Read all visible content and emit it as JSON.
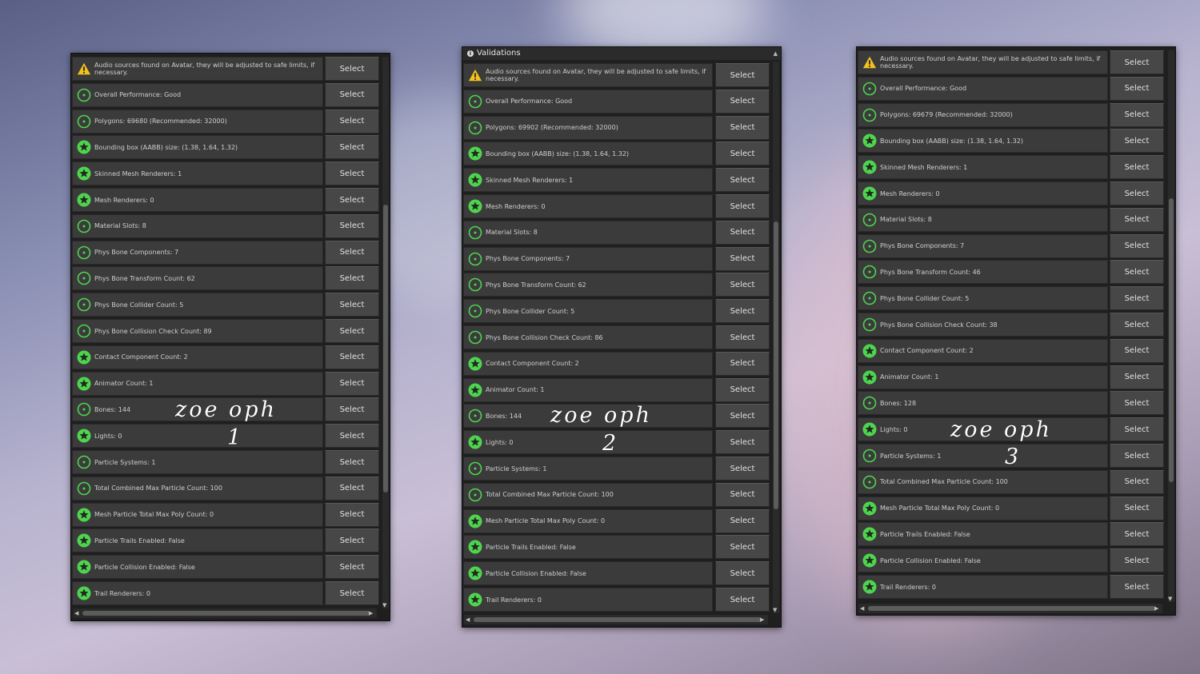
{
  "panels": [
    {
      "has_title": false,
      "title": "",
      "handwriting": {
        "line1": "zoe oph",
        "line2": "1"
      },
      "rows": [
        {
          "icon": "warning",
          "text": "Audio sources found on Avatar, they will be adjusted to safe limits, if necessary.",
          "button": "Select"
        },
        {
          "icon": "info",
          "text": "Overall Performance: Good",
          "button": "Select"
        },
        {
          "icon": "info",
          "text": "Polygons: 69680 (Recommended: 32000)",
          "button": "Select"
        },
        {
          "icon": "star",
          "text": "Bounding box (AABB) size: (1.38, 1.64, 1.32)",
          "button": "Select"
        },
        {
          "icon": "star",
          "text": "Skinned Mesh Renderers: 1",
          "button": "Select"
        },
        {
          "icon": "star",
          "text": "Mesh Renderers: 0",
          "button": "Select"
        },
        {
          "icon": "info",
          "text": "Material Slots: 8",
          "button": "Select"
        },
        {
          "icon": "info",
          "text": "Phys Bone Components: 7",
          "button": "Select"
        },
        {
          "icon": "info",
          "text": "Phys Bone Transform Count: 62",
          "button": "Select"
        },
        {
          "icon": "info",
          "text": "Phys Bone Collider Count: 5",
          "button": "Select"
        },
        {
          "icon": "info",
          "text": "Phys Bone Collision Check Count: 89",
          "button": "Select"
        },
        {
          "icon": "star",
          "text": "Contact Component Count: 2",
          "button": "Select"
        },
        {
          "icon": "star",
          "text": "Animator Count: 1",
          "button": "Select"
        },
        {
          "icon": "info",
          "text": "Bones: 144",
          "button": "Select"
        },
        {
          "icon": "star",
          "text": "Lights: 0",
          "button": "Select"
        },
        {
          "icon": "info",
          "text": "Particle Systems: 1",
          "button": "Select"
        },
        {
          "icon": "info",
          "text": "Total Combined Max Particle Count: 100",
          "button": "Select"
        },
        {
          "icon": "star",
          "text": "Mesh Particle Total Max Poly Count: 0",
          "button": "Select"
        },
        {
          "icon": "star",
          "text": "Particle Trails Enabled: False",
          "button": "Select"
        },
        {
          "icon": "star",
          "text": "Particle Collision Enabled: False",
          "button": "Select"
        },
        {
          "icon": "star",
          "text": "Trail Renderers: 0",
          "button": "Select"
        }
      ]
    },
    {
      "has_title": true,
      "title": "Validations",
      "handwriting": {
        "line1": "zoe oph",
        "line2": "2"
      },
      "rows": [
        {
          "icon": "warning",
          "text": "Audio sources found on Avatar, they will be adjusted to safe limits, if necessary.",
          "button": "Select"
        },
        {
          "icon": "info",
          "text": "Overall Performance: Good",
          "button": "Select"
        },
        {
          "icon": "info",
          "text": "Polygons: 69902 (Recommended: 32000)",
          "button": "Select"
        },
        {
          "icon": "star",
          "text": "Bounding box (AABB) size: (1.38, 1.64, 1.32)",
          "button": "Select"
        },
        {
          "icon": "star",
          "text": "Skinned Mesh Renderers: 1",
          "button": "Select"
        },
        {
          "icon": "star",
          "text": "Mesh Renderers: 0",
          "button": "Select"
        },
        {
          "icon": "info",
          "text": "Material Slots: 8",
          "button": "Select"
        },
        {
          "icon": "info",
          "text": "Phys Bone Components: 7",
          "button": "Select"
        },
        {
          "icon": "info",
          "text": "Phys Bone Transform Count: 62",
          "button": "Select"
        },
        {
          "icon": "info",
          "text": "Phys Bone Collider Count: 5",
          "button": "Select"
        },
        {
          "icon": "info",
          "text": "Phys Bone Collision Check Count: 86",
          "button": "Select"
        },
        {
          "icon": "star",
          "text": "Contact Component Count: 2",
          "button": "Select"
        },
        {
          "icon": "star",
          "text": "Animator Count: 1",
          "button": "Select"
        },
        {
          "icon": "info",
          "text": "Bones: 144",
          "button": "Select"
        },
        {
          "icon": "star",
          "text": "Lights: 0",
          "button": "Select"
        },
        {
          "icon": "info",
          "text": "Particle Systems: 1",
          "button": "Select"
        },
        {
          "icon": "info",
          "text": "Total Combined Max Particle Count: 100",
          "button": "Select"
        },
        {
          "icon": "star",
          "text": "Mesh Particle Total Max Poly Count: 0",
          "button": "Select"
        },
        {
          "icon": "star",
          "text": "Particle Trails Enabled: False",
          "button": "Select"
        },
        {
          "icon": "star",
          "text": "Particle Collision Enabled: False",
          "button": "Select"
        },
        {
          "icon": "star",
          "text": "Trail Renderers: 0",
          "button": "Select"
        }
      ]
    },
    {
      "has_title": false,
      "title": "",
      "handwriting": {
        "line1": "zoe oph",
        "line2": "3"
      },
      "rows": [
        {
          "icon": "warning",
          "text": "Audio sources found on Avatar, they will be adjusted to safe limits, if necessary.",
          "button": "Select"
        },
        {
          "icon": "info",
          "text": "Overall Performance: Good",
          "button": "Select"
        },
        {
          "icon": "info",
          "text": "Polygons: 69679 (Recommended: 32000)",
          "button": "Select"
        },
        {
          "icon": "star",
          "text": "Bounding box (AABB) size: (1.38, 1.64, 1.32)",
          "button": "Select"
        },
        {
          "icon": "star",
          "text": "Skinned Mesh Renderers: 1",
          "button": "Select"
        },
        {
          "icon": "star",
          "text": "Mesh Renderers: 0",
          "button": "Select"
        },
        {
          "icon": "info",
          "text": "Material Slots: 8",
          "button": "Select"
        },
        {
          "icon": "info",
          "text": "Phys Bone Components: 7",
          "button": "Select"
        },
        {
          "icon": "info",
          "text": "Phys Bone Transform Count: 46",
          "button": "Select"
        },
        {
          "icon": "info",
          "text": "Phys Bone Collider Count: 5",
          "button": "Select"
        },
        {
          "icon": "info",
          "text": "Phys Bone Collision Check Count: 38",
          "button": "Select"
        },
        {
          "icon": "star",
          "text": "Contact Component Count: 2",
          "button": "Select"
        },
        {
          "icon": "star",
          "text": "Animator Count: 1",
          "button": "Select"
        },
        {
          "icon": "info",
          "text": "Bones: 128",
          "button": "Select"
        },
        {
          "icon": "star",
          "text": "Lights: 0",
          "button": "Select"
        },
        {
          "icon": "info",
          "text": "Particle Systems: 1",
          "button": "Select"
        },
        {
          "icon": "info",
          "text": "Total Combined Max Particle Count: 100",
          "button": "Select"
        },
        {
          "icon": "star",
          "text": "Mesh Particle Total Max Poly Count: 0",
          "button": "Select"
        },
        {
          "icon": "star",
          "text": "Particle Trails Enabled: False",
          "button": "Select"
        },
        {
          "icon": "star",
          "text": "Particle Collision Enabled: False",
          "button": "Select"
        },
        {
          "icon": "star",
          "text": "Trail Renderers: 0",
          "button": "Select"
        }
      ]
    }
  ],
  "colors": {
    "icon_green": "#4fd44f",
    "warning_yellow": "#f1c21b",
    "row_bg": "#3b3b3b",
    "button_bg": "#474747",
    "panel_bg": "#1f1f1f"
  }
}
